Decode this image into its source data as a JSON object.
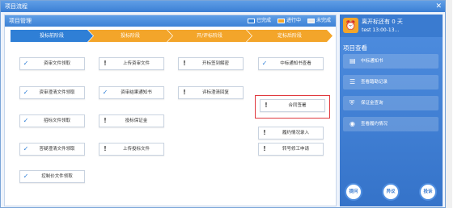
{
  "window": {
    "title": "项目流程",
    "close_glyph": "✕"
  },
  "panel": {
    "title": "项目管理"
  },
  "legend": [
    {
      "label": "已完成",
      "color": "#2f7fd6"
    },
    {
      "label": "进行中",
      "color": "#f3a52a"
    },
    {
      "label": "未完成",
      "color": "#e6e6e6"
    }
  ],
  "phases": [
    {
      "label": "投标前阶段",
      "color": "#2f7fd6"
    },
    {
      "label": "投标阶段",
      "color": "#f3a52a"
    },
    {
      "label": "开/评标阶段",
      "color": "#f3a52a"
    },
    {
      "label": "定标后阶段",
      "color": "#f3a52a"
    }
  ],
  "tasks": [
    {
      "label": "资审文件领取",
      "status": "done"
    },
    {
      "label": "上传资审文件",
      "status": "pending"
    },
    {
      "label": "开标签到解密",
      "status": "pending"
    },
    {
      "label": "中标通知书查看",
      "status": "done"
    },
    {
      "label": "资审澄清文件领取",
      "status": "done"
    },
    {
      "label": "资审结果通知书",
      "status": "done"
    },
    {
      "label": "评标澄清回复",
      "status": "pending"
    },
    {
      "label": "合同签署",
      "status": "pending"
    },
    {
      "label": "招标文件领取",
      "status": "done"
    },
    {
      "label": "投标保证金",
      "status": "pending"
    },
    {
      "label": "履约情况录入",
      "status": "pending"
    },
    {
      "label": "答疑澄清文件领取",
      "status": "done"
    },
    {
      "label": "上传投标文件",
      "status": "pending"
    },
    {
      "label": "转号修工申请",
      "status": "pending"
    },
    {
      "label": "控制价文件领取",
      "status": "done"
    }
  ],
  "sidebar": {
    "countdown_text": "离开标还有 0 天",
    "countdown_time": "test 13:00-13...",
    "section_title": "项目查看",
    "buttons": [
      {
        "label": "中标通知书",
        "icon": "document-icon"
      },
      {
        "label": "查看踏勘记录",
        "icon": "list-icon"
      },
      {
        "label": "保证金查询",
        "icon": "shield-icon"
      },
      {
        "label": "查看履约情况",
        "icon": "eye-icon"
      }
    ],
    "round_buttons": [
      "提问",
      "异议",
      "投诉"
    ]
  }
}
